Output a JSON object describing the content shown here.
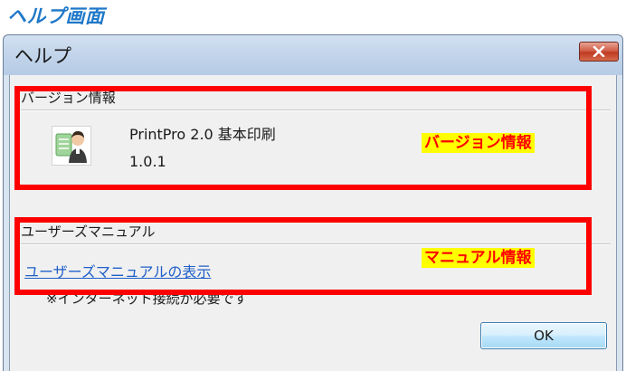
{
  "page": {
    "heading": "ヘルプ画面"
  },
  "dialog": {
    "title": "ヘルプ",
    "close_icon": "close-icon",
    "version_group": {
      "label": "バージョン情報",
      "product_name": "PrintPro 2.0 基本印刷",
      "product_version": "1.0.1",
      "icon": "user-with-document-icon"
    },
    "manual_group": {
      "label": "ユーザーズマニュアル",
      "link_text": "ユーザーズマニュアルの表示",
      "note": "※インターネット接続が必要です"
    },
    "ok_label": "OK"
  },
  "annotations": {
    "version_callout": "バージョン情報",
    "manual_callout": "マニュアル情報",
    "highlight_color": "#ff0000",
    "callout_background": "#ffff00"
  }
}
